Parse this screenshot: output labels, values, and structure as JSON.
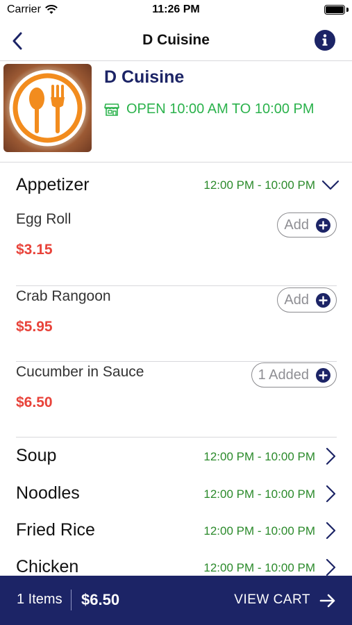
{
  "status_bar": {
    "carrier": "Carrier",
    "time": "11:26 PM"
  },
  "nav": {
    "title": "D Cuisine"
  },
  "restaurant": {
    "name": "D Cuisine",
    "hours": "OPEN 10:00 AM TO 10:00 PM"
  },
  "categories": [
    {
      "name": "Appetizer",
      "time": "12:00 PM - 10:00 PM",
      "expanded": true
    },
    {
      "name": "Soup",
      "time": "12:00 PM - 10:00 PM"
    },
    {
      "name": "Noodles",
      "time": "12:00 PM - 10:00 PM"
    },
    {
      "name": "Fried Rice",
      "time": "12:00 PM - 10:00 PM"
    },
    {
      "name": "Chicken",
      "time": "12:00 PM - 10:00 PM"
    }
  ],
  "items": [
    {
      "name": "Egg Roll",
      "price": "$3.15",
      "button": "Add"
    },
    {
      "name": "Crab Rangoon",
      "price": "$5.95",
      "button": "Add"
    },
    {
      "name": "Cucumber in Sauce",
      "price": "$6.50",
      "button": "1 Added"
    }
  ],
  "cart": {
    "items": "1 Items",
    "total": "$6.50",
    "action": "VIEW CART"
  },
  "colors": {
    "navy": "#1c2466",
    "green": "#2bb24c",
    "price_red": "#e8433a",
    "logo_orange": "#f28c1e"
  }
}
